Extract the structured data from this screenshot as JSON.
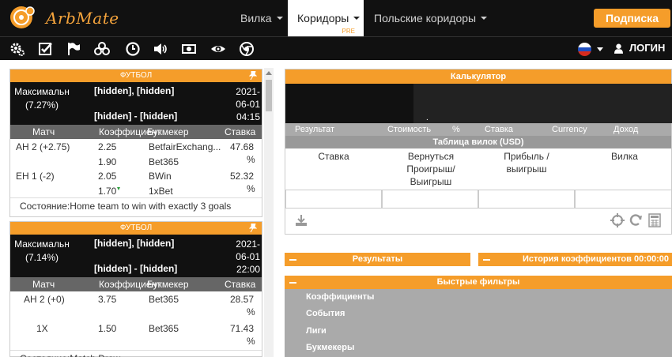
{
  "app": {
    "name": "ArbMate"
  },
  "nav": {
    "items": [
      {
        "label": "Вилка"
      },
      {
        "label": "Коридоры",
        "badge": "PRE"
      },
      {
        "label": "Польские коридоры"
      }
    ],
    "subscribe": "Подписка",
    "login": "ЛОГИН"
  },
  "toolbar": {
    "icons": [
      "settings-icon",
      "checklist-icon",
      "flag-icon",
      "layers-icon",
      "clock-icon",
      "volume-icon",
      "money-icon",
      "eye-icon",
      "chrome-icon"
    ]
  },
  "cards": [
    {
      "sport": "ФУТБОЛ",
      "profit_label": "Максимальн",
      "profit_pct": "(7.27%)",
      "teams_line1": "[hidden], [hidden]",
      "teams_line2": "[hidden] - [hidden]",
      "date1": "2021-",
      "date2": "06-01",
      "time": "04:15",
      "headers": {
        "match": "Матч",
        "coef": "Коэффициент",
        "book": "Букмекер",
        "stake": "Ставка"
      },
      "rows": [
        {
          "market": "AH 2 (+2.75)",
          "coef": "2.25",
          "coef2": "1.90",
          "book": "BetfairExchang...",
          "book2": "Bet365",
          "stake": "47.68",
          "pct": "%"
        },
        {
          "market": "EH 1 (-2)",
          "coef": "2.05",
          "coef2": "1.70",
          "book": "BWin",
          "book2": "1xBet",
          "stake": "52.32",
          "pct": "%"
        }
      ],
      "state": "Состояние:Home team to win with exactly 3 goals"
    },
    {
      "sport": "ФУТБОЛ",
      "profit_label": "Максимальн",
      "profit_pct": "(7.14%)",
      "teams_line1": "[hidden], [hidden]",
      "teams_line2": "[hidden] - [hidden]",
      "date1": "2021-",
      "date2": "06-01",
      "time": "22:00",
      "headers": {
        "match": "Матч",
        "coef": "Коэффициент",
        "book": "Букмекер",
        "stake": "Ставка"
      },
      "rows": [
        {
          "market": "AH 2 (+0)",
          "coef": "3.75",
          "book": "Bet365",
          "stake": "28.57",
          "pct": "%"
        },
        {
          "market": "1X",
          "coef": "1.50",
          "book": "Bet365",
          "stake": "71.43",
          "pct": "%"
        }
      ],
      "state": "Состояние:Match Draw"
    }
  ],
  "calculator": {
    "title": "Калькулятор",
    "dot": ".",
    "columns": [
      "Результат",
      "Стоимость",
      "%",
      "Ставка",
      "Currency",
      "Доход"
    ],
    "table_title": "Таблица вилок (USD)",
    "grid": [
      {
        "text": "Ставка"
      },
      {
        "text": "Вернуться Проигрыш/ Выигрыш"
      },
      {
        "text": "Прибыль / выигрыш"
      },
      {
        "text": "Вилка"
      }
    ]
  },
  "results": {
    "label": "Результаты"
  },
  "history": {
    "label": "История коэффициентов 00:00:00"
  },
  "quick_filters": {
    "title": "Быстрые фильтры",
    "items": [
      "Коэффициенты",
      "События",
      "Лиги",
      "Букмекеры"
    ]
  },
  "colors": {
    "accent": "#f59d2a",
    "dark": "#111111",
    "gray": "#aaaaaa"
  }
}
